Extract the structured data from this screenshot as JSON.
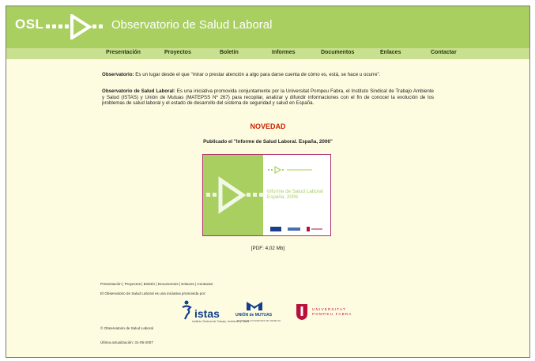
{
  "header": {
    "logo_text": "OSL",
    "title": "Observatorio de Salud Laboral",
    "accent_color": "#a9cf61"
  },
  "nav": {
    "items": [
      {
        "label": "Presentación"
      },
      {
        "label": "Proyectos"
      },
      {
        "label": "Boletín"
      },
      {
        "label": "Informes"
      },
      {
        "label": "Documentos"
      },
      {
        "label": "Enlaces"
      },
      {
        "label": "Contactar"
      }
    ]
  },
  "intro": {
    "p1_term": "Observatorio:",
    "p1_text": " Es un lugar desde el que \"mirar o prestar atención a algo para darse cuenta de cómo es, está, se hace u ocurre\".",
    "p2_term": "Observatorio de Salud Laboral:",
    "p2_text": " Es una iniciativa promovida conjuntamente por la Universitat Pompeu Fabra, el Instituto Sindical de Trabajo Ambiente y Salud (ISTAS) y Unión de Mutuas (MATEPSS Nº 267) para recopilar, analizar y difundir informaciones con el fin de conocer la evolución de los problemas de salud laboral y el estado de desarrollo del sistema de seguridad y salud en España."
  },
  "novedad": {
    "heading": "NOVEDAD",
    "published": "Publicado el \"Informe de Salud Laboral. España, 2006\"",
    "cover_title_line1": "Informe de Salud Laboral",
    "cover_title_line2": "España, 2006",
    "pdf_link": "[PDF: 4,02 Mb]",
    "heading_color": "#cc2200"
  },
  "footer": {
    "links": [
      {
        "label": "Presentación"
      },
      {
        "label": "Proyectos"
      },
      {
        "label": "Boletín"
      },
      {
        "label": "Documentos"
      },
      {
        "label": "Enlaces"
      },
      {
        "label": "Contactar"
      }
    ],
    "separator": " | ",
    "promoted_by": "El Observatorio de Salud Laboral es una iniciativa promovida por:",
    "partners": {
      "istas": "istas",
      "istas_sub": "Instituto Sindical de Trabajo, Ambiente y Salud",
      "union": "UNIÓN de MUTUAS",
      "union_sub": "MUTUA DE ACCIDENTES DE TRABAJO",
      "upf_line1": "UNIVERSITAT",
      "upf_line2": "POMPEU FABRA"
    },
    "copyright": "© Observatorio de Salud Laboral",
    "last_update": "Última actualización: 31-05-2007"
  }
}
